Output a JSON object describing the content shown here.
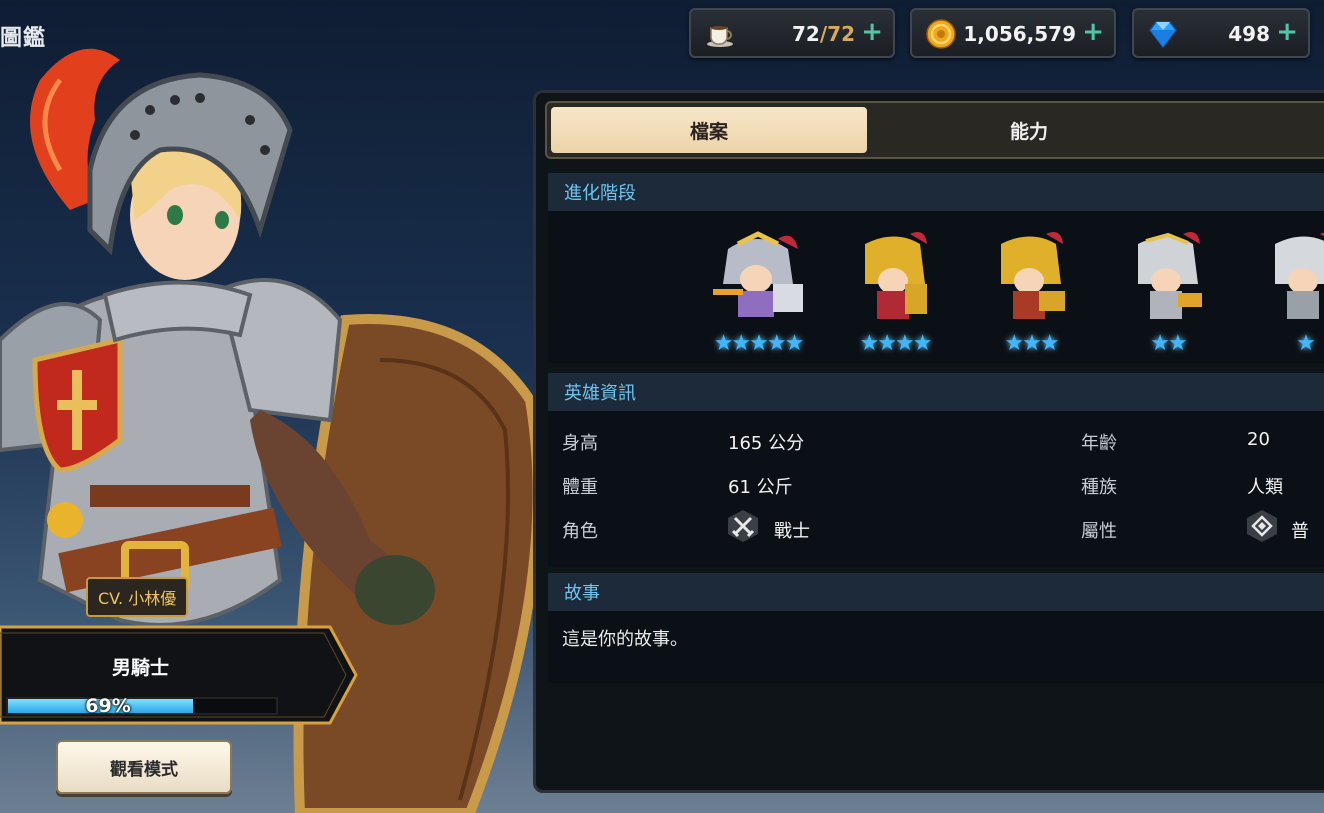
{
  "page": {
    "title": "圖鑑"
  },
  "currencies": {
    "stamina": {
      "current": "72",
      "max": "72",
      "icon": "coffee-cup-icon"
    },
    "gold": {
      "value": "1,056,579",
      "icon": "gold-coin-icon"
    },
    "gems": {
      "value": "498",
      "icon": "blue-gem-icon"
    }
  },
  "hero": {
    "cv": "CV. 小林優",
    "name": "男騎士",
    "progress_percent": 69,
    "progress_label": "69%",
    "view_mode_button": "觀看模式"
  },
  "tabs": [
    {
      "label": "檔案",
      "active": true
    },
    {
      "label": "能力",
      "active": false
    }
  ],
  "evolution": {
    "header": "進化階段",
    "stages": [
      {
        "stars": 5,
        "star_text": "★★★★★"
      },
      {
        "stars": 4,
        "star_text": "★★★★"
      },
      {
        "stars": 3,
        "star_text": "★★★"
      },
      {
        "stars": 2,
        "star_text": "★★"
      },
      {
        "stars": 1,
        "star_text": "★"
      }
    ]
  },
  "hero_info": {
    "header": "英雄資訊",
    "height_label": "身高",
    "height_value": "165 公分",
    "weight_label": "體重",
    "weight_value": "61 公斤",
    "role_label": "角色",
    "role_value": "戰士",
    "role_icon": "crossed-swords-icon",
    "age_label": "年齡",
    "age_value": "20",
    "race_label": "種族",
    "race_value": "人類",
    "element_label": "屬性",
    "element_value": "普",
    "element_icon": "basic-element-icon"
  },
  "story": {
    "header": "故事",
    "text": "這是你的故事。"
  },
  "colors": {
    "accent_blue": "#6fc3f0",
    "star_blue": "#3fb6ff",
    "tab_active": "#f6e6c8",
    "plus_green": "#4fc7a7",
    "gold_border": "#c99a3c"
  }
}
